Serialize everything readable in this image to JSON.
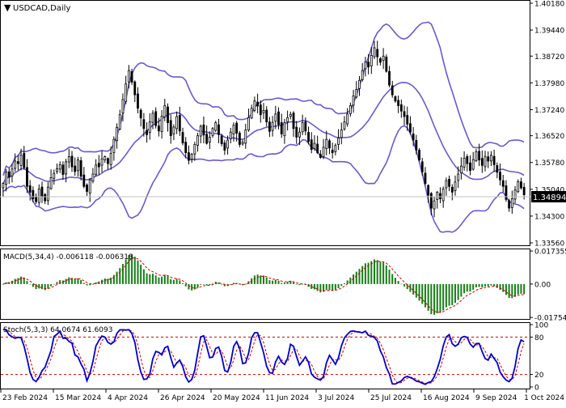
{
  "chart_data": [
    {
      "type": "candlestick",
      "title": "USDCAD,Daily",
      "symbol": "USDCAD",
      "timeframe": "Daily",
      "current_price": "1.34894",
      "y_ticks": [
        "1.40180",
        "1.39440",
        "1.38720",
        "1.37980",
        "1.37240",
        "1.36520",
        "1.35780",
        "1.35040",
        "1.34300",
        "1.33560"
      ],
      "x_ticks": [
        "23 Feb 2024",
        "15 Mar 2024",
        "4 Apr 2024",
        "26 Apr 2024",
        "20 May 2024",
        "11 Jun 2024",
        "3 Jul 2024",
        "25 Jul 2024",
        "16 Aug 2024",
        "9 Sep 2024",
        "1 Oct 2024"
      ],
      "ylim": [
        1.3356,
        1.4018
      ],
      "overlays": [
        "Bollinger Bands"
      ],
      "close": [
        1.352,
        1.3552,
        1.3538,
        1.356,
        1.3582,
        1.3575,
        1.3598,
        1.3564,
        1.3512,
        1.3496,
        1.3478,
        1.347,
        1.3505,
        1.3485,
        1.3472,
        1.351,
        1.3536,
        1.3548,
        1.3561,
        1.3572,
        1.3545,
        1.358,
        1.3594,
        1.3566,
        1.3553,
        1.3585,
        1.354,
        1.3512,
        1.3498,
        1.353,
        1.3546,
        1.3571,
        1.3566,
        1.3588,
        1.3594,
        1.3575,
        1.3603,
        1.3642,
        1.3675,
        1.371,
        1.3752,
        1.3795,
        1.3832,
        1.38,
        1.3765,
        1.3728,
        1.3701,
        1.3672,
        1.3655,
        1.369,
        1.3714,
        1.368,
        1.3665,
        1.3706,
        1.3735,
        1.3688,
        1.3652,
        1.3676,
        1.3705,
        1.3665,
        1.3632,
        1.3605,
        1.3584,
        1.3601,
        1.3628,
        1.3652,
        1.3678,
        1.3654,
        1.3631,
        1.3648,
        1.3672,
        1.3688,
        1.3655,
        1.363,
        1.3612,
        1.364,
        1.3662,
        1.3681,
        1.3659,
        1.3628,
        1.3634,
        1.3668,
        1.3702,
        1.3728,
        1.3748,
        1.3734,
        1.371,
        1.3722,
        1.369,
        1.3664,
        1.3689,
        1.3712,
        1.3683,
        1.3657,
        1.3688,
        1.3702,
        1.3711,
        1.3672,
        1.3648,
        1.3662,
        1.3688,
        1.3665,
        1.3636,
        1.3614,
        1.3631,
        1.3605,
        1.3592,
        1.362,
        1.3642,
        1.3618,
        1.3605,
        1.3625,
        1.3646,
        1.3668,
        1.369,
        1.3712,
        1.3735,
        1.3762,
        1.378,
        1.3805,
        1.3832,
        1.3856,
        1.3842,
        1.3874,
        1.3895,
        1.387,
        1.3855,
        1.3872,
        1.383,
        1.3792,
        1.3765,
        1.3748,
        1.3735,
        1.372,
        1.3705,
        1.3684,
        1.3662,
        1.364,
        1.3612,
        1.3585,
        1.3552,
        1.352,
        1.3488,
        1.3452,
        1.3472,
        1.3496,
        1.3478,
        1.3505,
        1.3528,
        1.3512,
        1.3496,
        1.3524,
        1.3546,
        1.3568,
        1.359,
        1.3575,
        1.3556,
        1.3586,
        1.3608,
        1.3585,
        1.357,
        1.3595,
        1.3582,
        1.3598,
        1.3572,
        1.3551,
        1.353,
        1.3512,
        1.3476,
        1.3452,
        1.3478,
        1.3502,
        1.3525,
        1.3508,
        1.3489
      ],
      "indicators": [
        {
          "name": "MACD(5,34,4)",
          "label": "MACD(5,34,4) -0.006118 -0.006318",
          "values": [
            "-0.006118",
            "-0.006318"
          ],
          "y_ticks": [
            "0.017355",
            "0.00",
            "-0.017542"
          ],
          "ylim": [
            -0.0175,
            0.0174
          ]
        },
        {
          "name": "Stoch(5,3,3)",
          "label": "Stoch(5,3,3) 64.0674 61.6093",
          "values": [
            "64.0674",
            "61.6093"
          ],
          "y_ticks": [
            "100",
            "80",
            "20",
            "0"
          ],
          "levels": [
            80,
            20
          ]
        }
      ]
    }
  ],
  "colors": {
    "bull": "#ffffff",
    "bear": "#000000",
    "bands": "#6a5acd",
    "macd_hist": "#1a7f1a",
    "macd_signal": "#cc0000",
    "stoch_main": "#0000cc",
    "stoch_signal": "#cc0000",
    "grid_level": "#cc0000"
  }
}
